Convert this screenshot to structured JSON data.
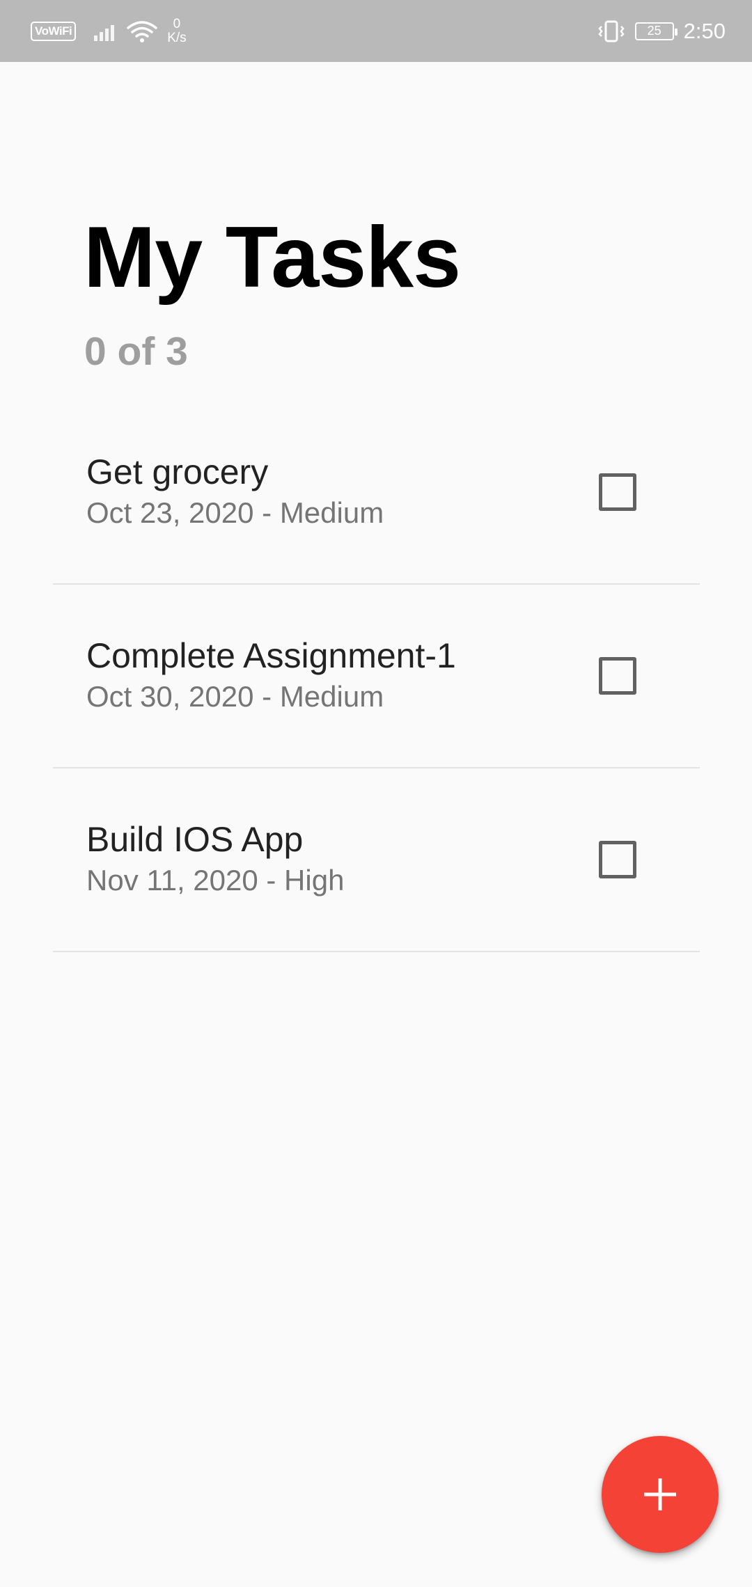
{
  "status_bar": {
    "vowifi": "VoWiFi",
    "speed_value": "0",
    "speed_unit": "K/s",
    "battery": "25",
    "time": "2:50"
  },
  "header": {
    "title": "My Tasks",
    "count": "0 of 3"
  },
  "tasks": [
    {
      "title": "Get grocery",
      "meta": "Oct 23, 2020 - Medium",
      "checked": false
    },
    {
      "title": "Complete Assignment-1",
      "meta": "Oct 30, 2020 - Medium",
      "checked": false
    },
    {
      "title": "Build IOS App",
      "meta": "Nov 11, 2020 - High",
      "checked": false
    }
  ],
  "fab": {
    "icon": "plus-icon"
  },
  "colors": {
    "status_bar": "#b9b9b9",
    "background": "#fafafa",
    "accent": "#f44336",
    "count_text": "#9e9e9e",
    "meta_text": "#757575"
  }
}
